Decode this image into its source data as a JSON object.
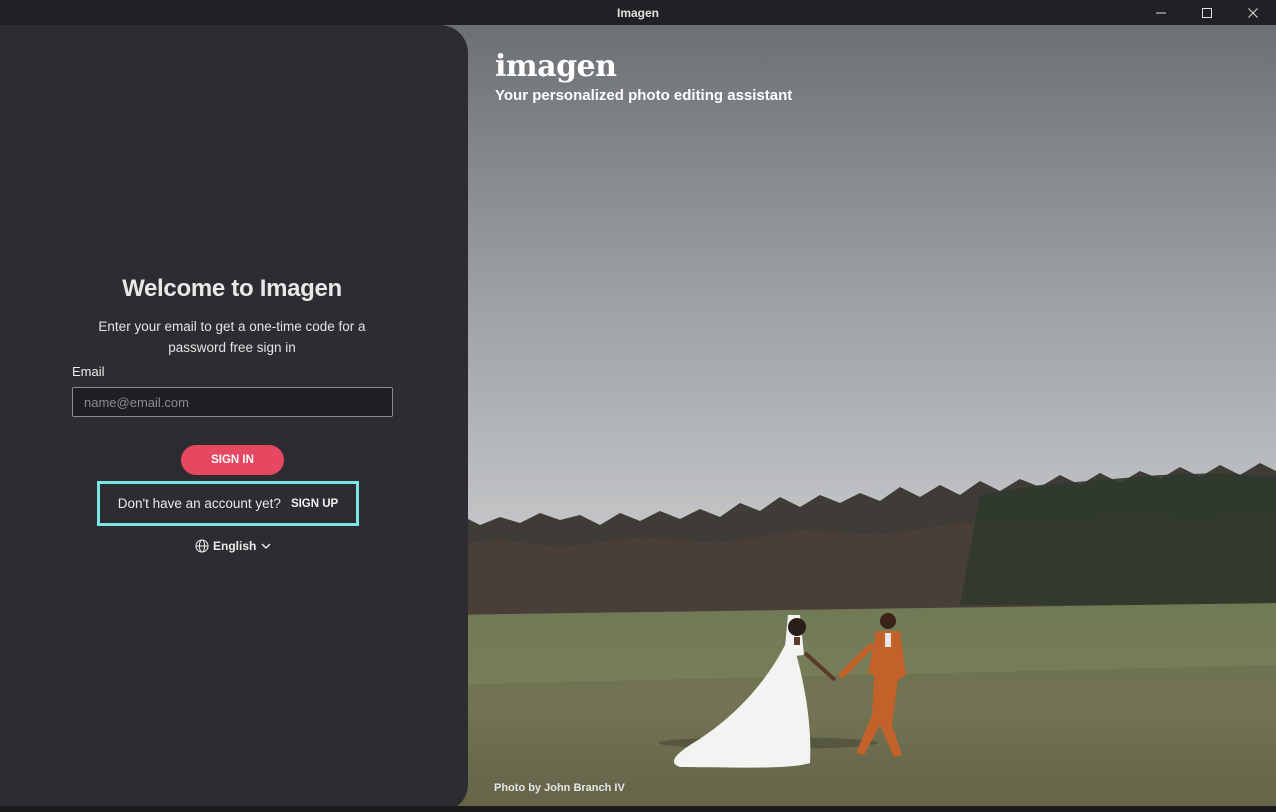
{
  "window": {
    "title": "Imagen"
  },
  "hero": {
    "logo": "imagen",
    "tagline": "Your personalized photo editing assistant",
    "photo_credit": "Photo by John Branch IV"
  },
  "signin": {
    "heading": "Welcome to Imagen",
    "subtitle": "Enter your email to get a one-time code for a password free sign in",
    "email_label": "Email",
    "email_placeholder": "name@email.com",
    "email_value": "",
    "signin_button": "SIGN IN",
    "signup_prompt": "Don't have an account yet?",
    "signup_link": "SIGN UP",
    "language": "English"
  },
  "colors": {
    "accent": "#e54860",
    "highlight": "#7be6e6",
    "panel": "#2d2c31"
  },
  "icons": [
    "minimize-icon",
    "maximize-icon",
    "close-icon",
    "globe-icon",
    "chevron-down-icon"
  ]
}
